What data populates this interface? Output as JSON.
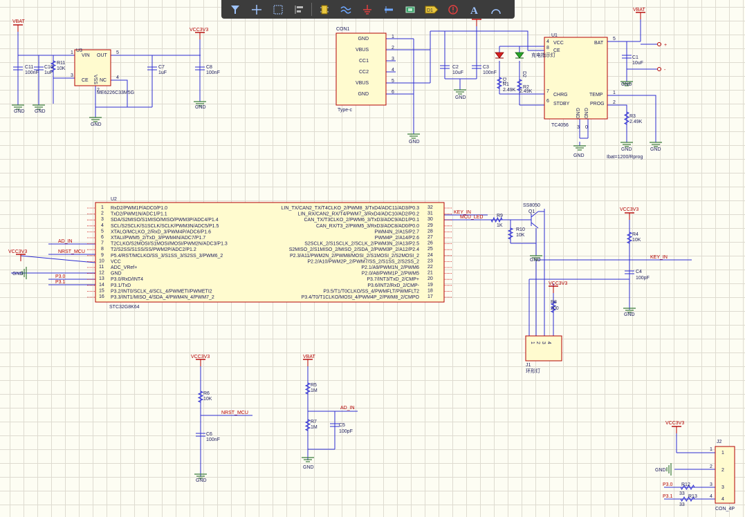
{
  "toolbar": {
    "tools": [
      {
        "name": "filter-icon"
      },
      {
        "name": "move-crosshair-icon"
      },
      {
        "name": "select-rectangle-icon"
      },
      {
        "name": "align-icon"
      },
      {
        "name": "component-icon"
      },
      {
        "name": "wire-icon"
      },
      {
        "name": "power-port-icon"
      },
      {
        "name": "bus-icon"
      },
      {
        "name": "harness-icon"
      },
      {
        "name": "net-label-icon",
        "label": "D1"
      },
      {
        "name": "no-erc-icon"
      },
      {
        "name": "text-icon",
        "label": "A"
      },
      {
        "name": "arc-icon"
      }
    ]
  },
  "schematic": {
    "nets": {
      "vbat": "VBAT",
      "vcc3v3": "VCC3V3",
      "gnd": "GND",
      "key_in": "KEY_IN",
      "mcu_led": "MCU_LED",
      "ad_in": "AD_IN",
      "nrst_mcu": "NRST_MCU",
      "p30": "P3.0",
      "p31": "P3.1"
    },
    "u3": {
      "ref": "U3",
      "part": "ME6226C33M5G",
      "pins": {
        "vin": "VIN",
        "out": "OUT",
        "ce": "CE",
        "nc": "NC",
        "vss": "VSS"
      },
      "pin_numbers": [
        "1",
        "5",
        "3",
        "4",
        "2"
      ]
    },
    "c11": {
      "ref": "C11",
      "value": "100nF"
    },
    "c10": {
      "ref": "C10",
      "value": "1uF"
    },
    "r11": {
      "ref": "R11",
      "value": "10K"
    },
    "c7": {
      "ref": "C7",
      "value": "1uF"
    },
    "c8": {
      "ref": "C8",
      "value": "100nF"
    },
    "con1": {
      "ref": "CON1",
      "part": "Type-c",
      "pins": [
        {
          "num": "1",
          "name": "GND"
        },
        {
          "num": "2",
          "name": "VBUS"
        },
        {
          "num": "3",
          "name": "CC1"
        },
        {
          "num": "4",
          "name": "CC2"
        },
        {
          "num": "5",
          "name": "VBUS"
        },
        {
          "num": "6",
          "name": "GND"
        }
      ]
    },
    "c2": {
      "ref": "C2",
      "value": "10uF"
    },
    "c3": {
      "ref": "C3",
      "value": "100nF"
    },
    "charge_leds": {
      "d1": "D1",
      "d2": "D2",
      "label": "充电指示灯"
    },
    "r1": {
      "ref": "R1",
      "value": "2.49K"
    },
    "r2": {
      "ref": "R2",
      "value": "2.49K"
    },
    "u1": {
      "ref": "U1",
      "part": "TC4056",
      "pins": {
        "vcc": "VCC",
        "ce": "CE",
        "chrg": "CHRG",
        "stdby": "STDBY",
        "bat": "BAT",
        "temp": "TEMP",
        "prog": "PROG",
        "gnd": "GND"
      },
      "pin_numbers": [
        "4",
        "8",
        "7",
        "6",
        "5",
        "1",
        "2",
        "3",
        "0"
      ]
    },
    "c1": {
      "ref": "C1",
      "value": "10uF"
    },
    "r3": {
      "ref": "R3",
      "value": "2.49K"
    },
    "ibat_note": "Ibat=1200/Rprog",
    "bat_plus": "+",
    "bat_minus": "-",
    "u2": {
      "ref": "U2",
      "part": "STC32G8K64",
      "left_pins": [
        {
          "num": "1",
          "name": "RxD2/PWM1P/ADC0/P1.0"
        },
        {
          "num": "2",
          "name": "TxD2/PWM1N/ADC1/P1.1"
        },
        {
          "num": "3",
          "name": "SDA/S2MISO/S1MISO/MISO/PWM3P/ADC4/P1.4"
        },
        {
          "num": "4",
          "name": "SCL/S2SCLK/S1SCLK/SCLK/PWM3N/ADC5/P1.5"
        },
        {
          "num": "5",
          "name": "XTALO/MCLKO_2/RxD_3/PWM4P/ADC6/P1.6"
        },
        {
          "num": "6",
          "name": "XTALI/PWM5_2/TxD_3/PWM4N/ADC7/P1.7"
        },
        {
          "num": "7",
          "name": "T2CLKO/S2MOSI/S1MOSI/MOSI/PWM2N/ADC3/P1.3"
        },
        {
          "num": "8",
          "name": "T2/S2SS/S1SS/SS/PWM2P/ADC2/P1.2"
        },
        {
          "num": "9",
          "name": "P5.4/RST/MCLKO/SS_3/S1SS_3/S2SS_3/PWM6_2"
        },
        {
          "num": "10",
          "name": "VCC"
        },
        {
          "num": "11",
          "name": "ADC_VRef+"
        },
        {
          "num": "12",
          "name": "GND"
        },
        {
          "num": "13",
          "name": "P3.0/RxD/INT4"
        },
        {
          "num": "14",
          "name": "P3.1/TxD"
        },
        {
          "num": "15",
          "name": "P3.2/INT0/SCLK_4/SCL_4/PWMETI/PWMETI2"
        },
        {
          "num": "16",
          "name": "P3.3/INT1/MISO_4/SDA_4/PWM4N_4/PWM7_2"
        }
      ],
      "right_pins": [
        {
          "num": "32",
          "name": "LIN_TX/CAN2_TX/T4CLKO_2/PWM8_3/TxD4/ADC11/AD3/P0.3"
        },
        {
          "num": "31",
          "name": "LIN_RX/CAN2_RX/T4/PWM7_3/RxD4/ADC10/AD2/P0.2"
        },
        {
          "num": "30",
          "name": "CAN_TX/T3CLKO_2/PWM6_3/TxD3/ADC9/AD1/P0.1"
        },
        {
          "num": "29",
          "name": "CAN_RX/T3_2/PWM5_3/RxD3/ADC8/AD0/P0.0"
        },
        {
          "num": "28",
          "name": "PWM4N_2/A15/P2.7"
        },
        {
          "num": "27",
          "name": "PWM4P_2/A14/P2.6"
        },
        {
          "num": "26",
          "name": "S2SCLK_2/S1SCLK_2/SCLK_2/PWM3N_2/A13/P2.5"
        },
        {
          "num": "25",
          "name": "S2MISO_2/S1MISO_2/MISO_2/SDA_2/PWM3P_2/A12/P2.4"
        },
        {
          "num": "24",
          "name": "P2.3/A11/PWM2N_2/PWM8/MOSI_2/S1MOSI_2/S2MOSI_2"
        },
        {
          "num": "23",
          "name": "P2.2/A10/PWM2P_2/PWM7/SS_2/S1SS_2/S2SS_2"
        },
        {
          "num": "22",
          "name": "P2.1/A9/PWM1N_2/PWM6"
        },
        {
          "num": "21",
          "name": "P2.0/A8/PWM1P_2/PWM5"
        },
        {
          "num": "20",
          "name": "P3.7/INT3/TxD_2/CMP+"
        },
        {
          "num": "19",
          "name": "P3.6/INT2/RxD_2/CMP-"
        },
        {
          "num": "18",
          "name": "P3.5/T1/T0CLKO/SS_4/PWMFLT/PWMFLT2"
        },
        {
          "num": "17",
          "name": "P3.4/T0/T1CLKO/MOSI_4/PWM4P_2/PWM8_2/CMPO"
        }
      ]
    },
    "r9": {
      "ref": "R9",
      "value": "1K"
    },
    "r10": {
      "ref": "R10",
      "value": "10K"
    },
    "q1": {
      "ref": "Q1",
      "part": "SS8050"
    },
    "r4": {
      "ref": "R4",
      "value": "10K"
    },
    "c4": {
      "ref": "C4",
      "value": "100pF"
    },
    "r8": {
      "ref": "R8",
      "value": "200"
    },
    "j1": {
      "ref": "J1",
      "label": "环形灯",
      "pins": [
        "1",
        "2",
        "3",
        "4"
      ]
    },
    "r6": {
      "ref": "R6",
      "value": "10K"
    },
    "c6": {
      "ref": "C6",
      "value": "100nF"
    },
    "r5": {
      "ref": "R5",
      "value": "1M"
    },
    "r7": {
      "ref": "R7",
      "value": "1M"
    },
    "c5": {
      "ref": "C5",
      "value": "100pF"
    },
    "j2": {
      "ref": "J2",
      "part": "CON_4P",
      "pins": [
        "1",
        "2",
        "3",
        "4"
      ]
    },
    "r12": {
      "ref": "R12",
      "value": "33"
    },
    "r13": {
      "ref": "R13",
      "value": "33"
    }
  }
}
